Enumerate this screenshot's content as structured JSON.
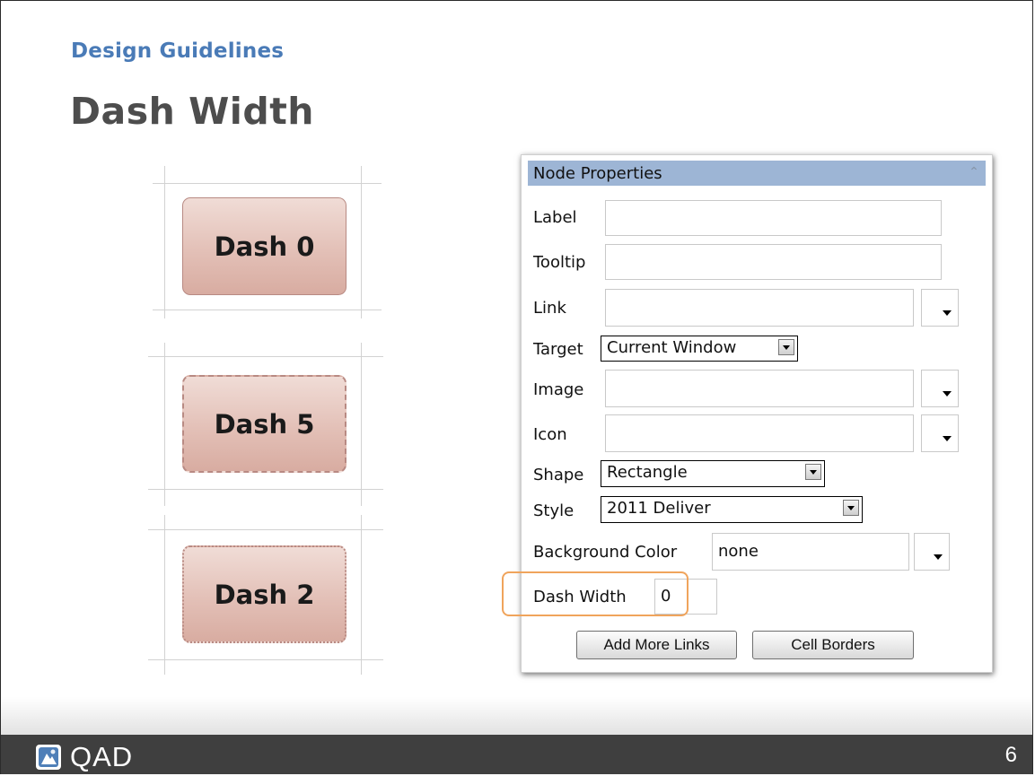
{
  "slide": {
    "section_label": "Design Guidelines",
    "title": "Dash Width",
    "page_number": "6"
  },
  "samples": [
    {
      "label": "Dash 0",
      "dash_width": 0
    },
    {
      "label": "Dash 5",
      "dash_width": 5
    },
    {
      "label": "Dash 2",
      "dash_width": 2
    }
  ],
  "panel": {
    "title": "Node Properties",
    "fields": {
      "label": {
        "label": "Label",
        "value": ""
      },
      "tooltip": {
        "label": "Tooltip",
        "value": ""
      },
      "link": {
        "label": "Link",
        "value": ""
      },
      "target": {
        "label": "Target",
        "value": "Current Window"
      },
      "image": {
        "label": "Image",
        "value": ""
      },
      "icon": {
        "label": "Icon",
        "value": ""
      },
      "shape": {
        "label": "Shape",
        "value": "Rectangle"
      },
      "style": {
        "label": "Style",
        "value": "2011 Deliver"
      },
      "background_color": {
        "label": "Background Color",
        "value": "none"
      },
      "dash_width": {
        "label": "Dash Width",
        "value": "0"
      }
    },
    "buttons": {
      "add_more_links": "Add More Links",
      "cell_borders": "Cell Borders"
    }
  },
  "footer": {
    "brand": "QAD"
  },
  "colors": {
    "section_label": "#4a7bb7",
    "title": "#4d4d4d",
    "panel_header": "#9db5d5",
    "highlight": "#f0a45c",
    "footer": "#3f3f3f"
  }
}
